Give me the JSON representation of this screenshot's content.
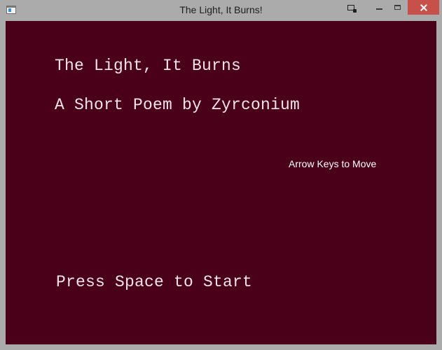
{
  "window": {
    "title": "The Light, It Burns!",
    "icons": {
      "app": "app-window-icon",
      "extra": "snap-window-icon",
      "minimize": "minimize-icon",
      "maximize": "maximize-icon",
      "close": "close-icon"
    },
    "colors": {
      "frame": "#ababab",
      "close_button": "#c7504b"
    }
  },
  "game": {
    "title": "The Light, It Burns",
    "subtitle": "A Short Poem by Zyrconium",
    "controls_hint": "Arrow Keys to Move",
    "start_prompt": "Press Space to Start",
    "colors": {
      "background": "#4a0019",
      "text": "#f1e4e7"
    }
  }
}
